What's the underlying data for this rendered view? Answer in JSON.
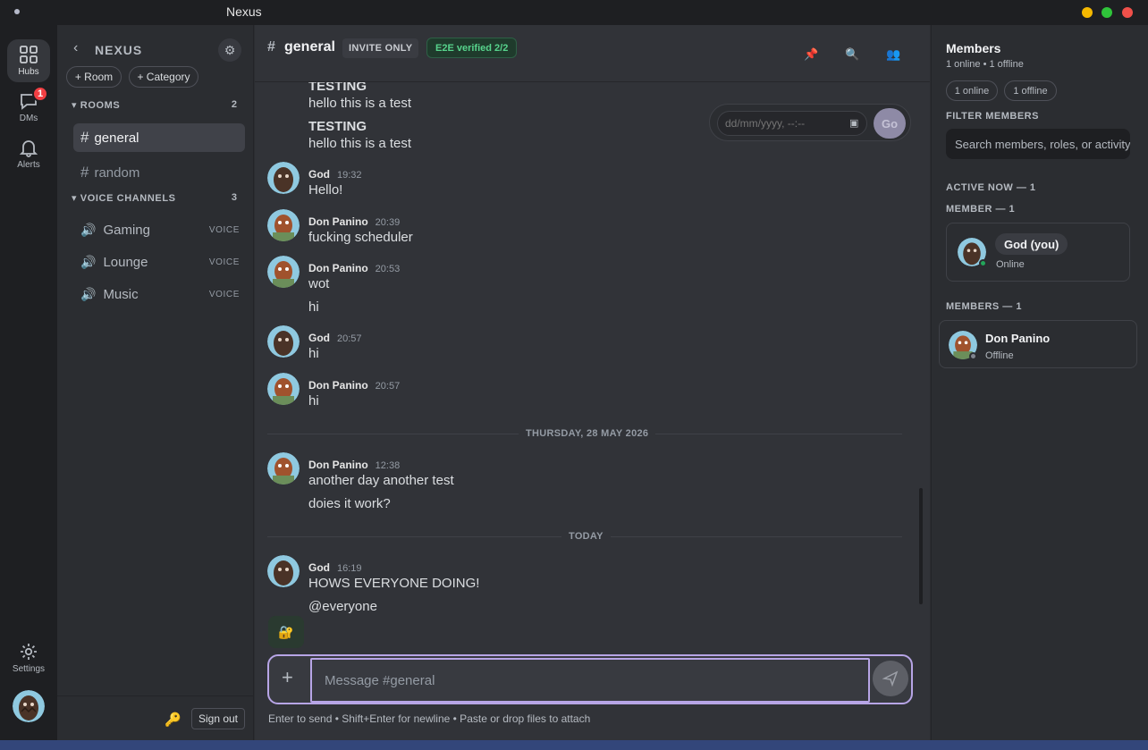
{
  "window": {
    "title": "Nexus"
  },
  "rail": {
    "hubs_label": "Hubs",
    "dms_label": "DMs",
    "dms_badge": "1",
    "alerts_label": "Alerts",
    "settings_label": "Settings"
  },
  "sidebar": {
    "hub_name": "NEXUS",
    "add_room": "+ Room",
    "add_category": "+ Category",
    "rooms_header": "ROOMS",
    "rooms_count": "2",
    "rooms": [
      {
        "name": "general"
      },
      {
        "name": "random"
      }
    ],
    "voice_header": "VOICE CHANNELS",
    "voice_count": "3",
    "voice_channels": [
      {
        "name": "Gaming",
        "tag": "VOICE"
      },
      {
        "name": "Lounge",
        "tag": "VOICE"
      },
      {
        "name": "Music",
        "tag": "VOICE"
      }
    ],
    "sign_out": "Sign out"
  },
  "chat": {
    "channel_name": "general",
    "invite_badge": "INVITE ONLY",
    "e2e_badge": "E2E verified 2/2",
    "jump_placeholder": "dd/mm/yyyy, --:--",
    "jump_go": "Go",
    "messages": [
      {
        "author": "",
        "time": "",
        "caps": "TESTING",
        "text": "hello this is a test"
      },
      {
        "author": "",
        "time": "",
        "caps": "TESTING",
        "text": "hello this is a test"
      },
      {
        "author": "God",
        "time": "19:32",
        "text": "Hello!"
      },
      {
        "author": "Don Panino",
        "time": "20:39",
        "text": "fucking scheduler"
      },
      {
        "author": "Don Panino",
        "time": "20:53",
        "text": "wot",
        "text2": "hi"
      },
      {
        "author": "God",
        "time": "20:57",
        "text": "hi"
      },
      {
        "author": "Don Panino",
        "time": "20:57",
        "text": "hi"
      },
      {
        "author": "Don Panino",
        "time": "12:38",
        "text": "another day another test",
        "text2": "doies it work?"
      },
      {
        "author": "God",
        "time": "16:19",
        "text": "HOWS EVERYONE DOING!",
        "text2": "@everyone"
      }
    ],
    "dividers": [
      "THURSDAY, 28 MAY 2026",
      "TODAY"
    ],
    "composer_placeholder": "Message #general",
    "hint": "Enter to send • Shift+Enter for newline • Paste or drop files to attach"
  },
  "members": {
    "title": "Members",
    "summary": "1 online • 1 offline",
    "online_pill": "1 online",
    "offline_pill": "1 offline",
    "filter_label": "FILTER MEMBERS",
    "search_placeholder": "Search members, roles, or activity",
    "active_now": "ACTIVE NOW — 1",
    "member_section": "MEMBER — 1",
    "members_section": "MEMBERS — 1",
    "you": {
      "name": "God (you)",
      "status": "Online"
    },
    "other": {
      "name": "Don Panino",
      "status": "Offline"
    },
    "status_colors": {
      "online": "#23a55a",
      "offline": "#80848e"
    }
  }
}
